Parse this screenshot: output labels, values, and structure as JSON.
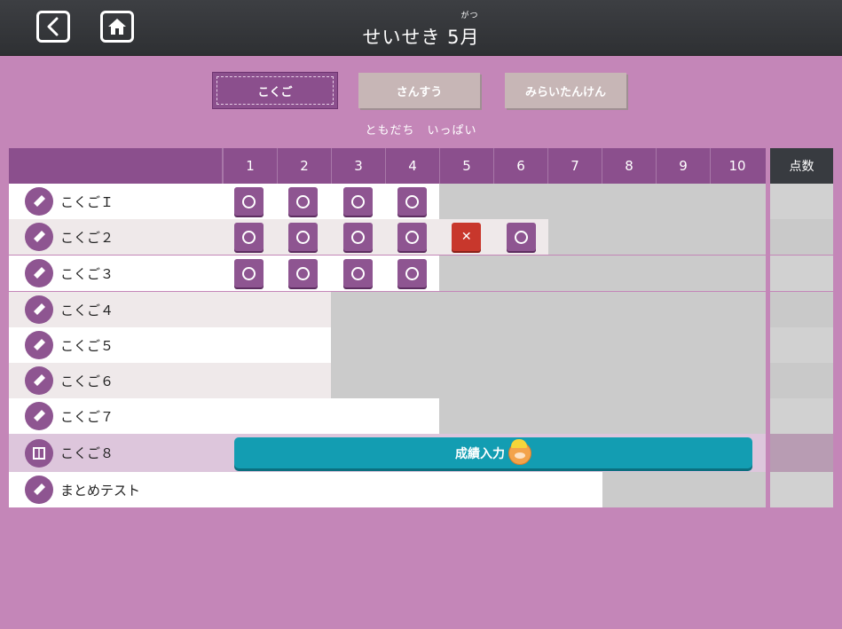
{
  "header": {
    "title_prefix": "せいせき 5",
    "title_kanji": "月",
    "title_ruby": "がつ",
    "back_icon": "chevron-left-icon",
    "home_icon": "home-icon"
  },
  "tabs": [
    {
      "label": "こくご",
      "active": true
    },
    {
      "label": "さんすう",
      "active": false
    },
    {
      "label": "みらいたんけん",
      "active": false
    }
  ],
  "subtitle": "ともだち　いっぱい",
  "columns": [
    "1",
    "2",
    "3",
    "4",
    "5",
    "6",
    "7",
    "8",
    "9",
    "10"
  ],
  "score_header": "点数",
  "rows": [
    {
      "label": "こくごＩ",
      "icon": "pencil-icon",
      "marks": [
        "o",
        "o",
        "o",
        "o"
      ],
      "white_cols": 4
    },
    {
      "label": "こくご２",
      "icon": "pencil-icon",
      "marks": [
        "o",
        "o",
        "o",
        "o",
        "x",
        "o"
      ],
      "white_cols": 6
    },
    {
      "label": "こくご３",
      "icon": "pencil-icon",
      "marks": [
        "o",
        "o",
        "o",
        "o"
      ],
      "white_cols": 4
    },
    {
      "label": "こくご４",
      "icon": "pencil-icon",
      "marks": [],
      "white_cols": 2
    },
    {
      "label": "こくご５",
      "icon": "pencil-icon",
      "marks": [],
      "white_cols": 2
    },
    {
      "label": "こくご６",
      "icon": "pencil-icon",
      "marks": [],
      "white_cols": 2
    },
    {
      "label": "こくご７",
      "icon": "pencil-icon",
      "marks": [],
      "white_cols": 4
    },
    {
      "label": "こくご８",
      "icon": "book-icon",
      "marks": [],
      "white_cols": 10,
      "input": true
    },
    {
      "label": "まとめテスト",
      "icon": "pencil-icon",
      "marks": [],
      "white_cols": 7
    }
  ],
  "input_button": {
    "label": "成績入力"
  },
  "colors": {
    "background": "#c486b8",
    "header": "#2e3033",
    "accent": "#8b4f8d",
    "correct_mark": "#8e5591",
    "wrong_mark": "#c8372c",
    "input_button": "#139db2"
  }
}
